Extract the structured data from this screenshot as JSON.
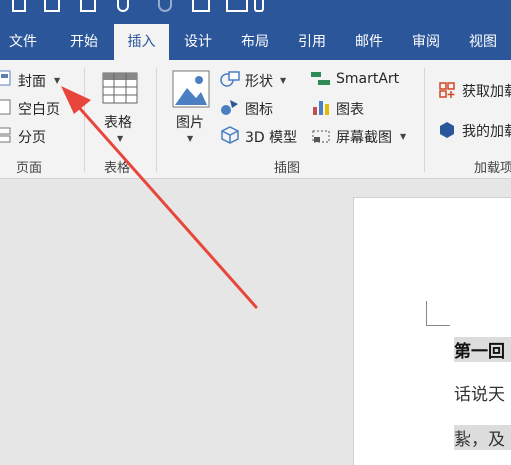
{
  "tabs": [
    {
      "label": "文件"
    },
    {
      "label": "开始"
    },
    {
      "label": "插入"
    },
    {
      "label": "设计"
    },
    {
      "label": "布局"
    },
    {
      "label": "引用"
    },
    {
      "label": "邮件"
    },
    {
      "label": "审阅"
    },
    {
      "label": "视图"
    }
  ],
  "active_tab": "插入",
  "ribbon": {
    "pages": {
      "cover": "封面",
      "blank_page": "空白页",
      "page_break": "分页",
      "group_label": "页面"
    },
    "tables": {
      "table": "表格",
      "group_label": "表格"
    },
    "illustrations": {
      "pictures": "图片",
      "shapes": "形状",
      "icons": "图标",
      "model_3d": "3D 模型",
      "smartart": "SmartArt",
      "chart": "图表",
      "screenshot": "屏幕截图",
      "group_label": "插图"
    },
    "addins": {
      "get_addins": "获取加载",
      "my_addins": "我的加载",
      "group_label": "加载项"
    }
  },
  "document": {
    "line1": "第一回",
    "line2": "话说天",
    "line3": "紥，及"
  },
  "colors": {
    "accent": "#2b579a",
    "ribbon_bg": "#f3f3f3",
    "arrow": "#e8463b"
  }
}
